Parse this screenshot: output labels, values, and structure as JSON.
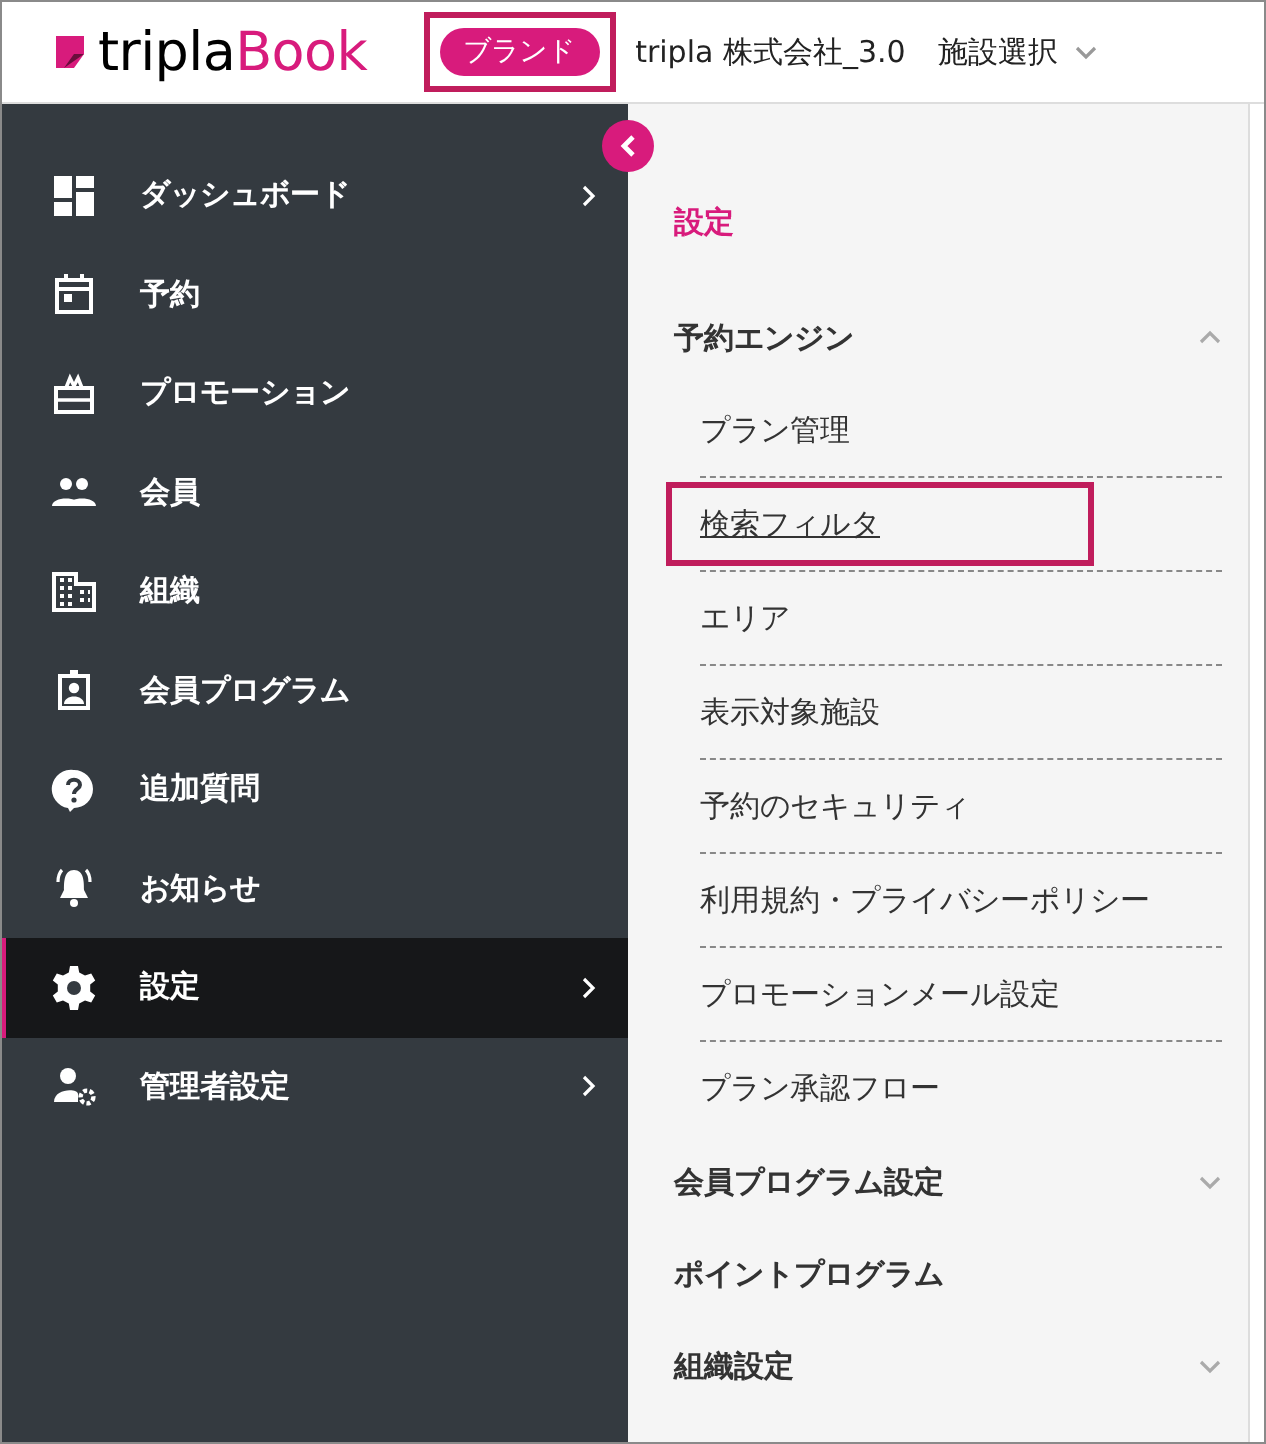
{
  "header": {
    "logo": {
      "part_1": "tripla",
      "part_2": "Book"
    },
    "brand_badge": {
      "label": "ブランド",
      "highlighted": true
    },
    "company": "tripla 株式会社_3.0",
    "facility_select": "施設選択"
  },
  "sidebar": {
    "items": [
      {
        "label": "ダッシュボード",
        "selected": false,
        "has_submenu": true
      },
      {
        "label": "予約",
        "selected": false,
        "has_submenu": false
      },
      {
        "label": "プロモーション",
        "selected": false,
        "has_submenu": false
      },
      {
        "label": "会員",
        "selected": false,
        "has_submenu": false
      },
      {
        "label": "組織",
        "selected": false,
        "has_submenu": false
      },
      {
        "label": "会員プログラム",
        "selected": false,
        "has_submenu": false
      },
      {
        "label": "追加質問",
        "selected": false,
        "has_submenu": false
      },
      {
        "label": "お知らせ",
        "selected": false,
        "has_submenu": false
      },
      {
        "label": "設定",
        "selected": true,
        "has_submenu": true
      },
      {
        "label": "管理者設定",
        "selected": false,
        "has_submenu": true
      }
    ]
  },
  "settings_panel": {
    "title": "設定",
    "sections": [
      {
        "label": "予約エンジン",
        "kind": "group",
        "expanded": true,
        "children": [
          {
            "label": "プラン管理",
            "highlighted": false,
            "underlined": false
          },
          {
            "label": "検索フィルタ",
            "highlighted": true,
            "underlined": true
          },
          {
            "label": "エリア",
            "highlighted": false,
            "underlined": false
          },
          {
            "label": "表示対象施設",
            "highlighted": false,
            "underlined": false
          },
          {
            "label": "予約のセキュリティ",
            "highlighted": false,
            "underlined": false
          },
          {
            "label": "利用規約・プライバシーポリシー",
            "highlighted": false,
            "underlined": false
          },
          {
            "label": "プロモーションメール設定",
            "highlighted": false,
            "underlined": false
          },
          {
            "label": "プラン承認フロー",
            "highlighted": false,
            "underlined": false
          }
        ]
      },
      {
        "label": "会員プログラム設定",
        "kind": "group",
        "expanded": false
      },
      {
        "label": "ポイントプログラム",
        "kind": "link"
      },
      {
        "label": "組織設定",
        "kind": "group",
        "expanded": false
      }
    ]
  }
}
